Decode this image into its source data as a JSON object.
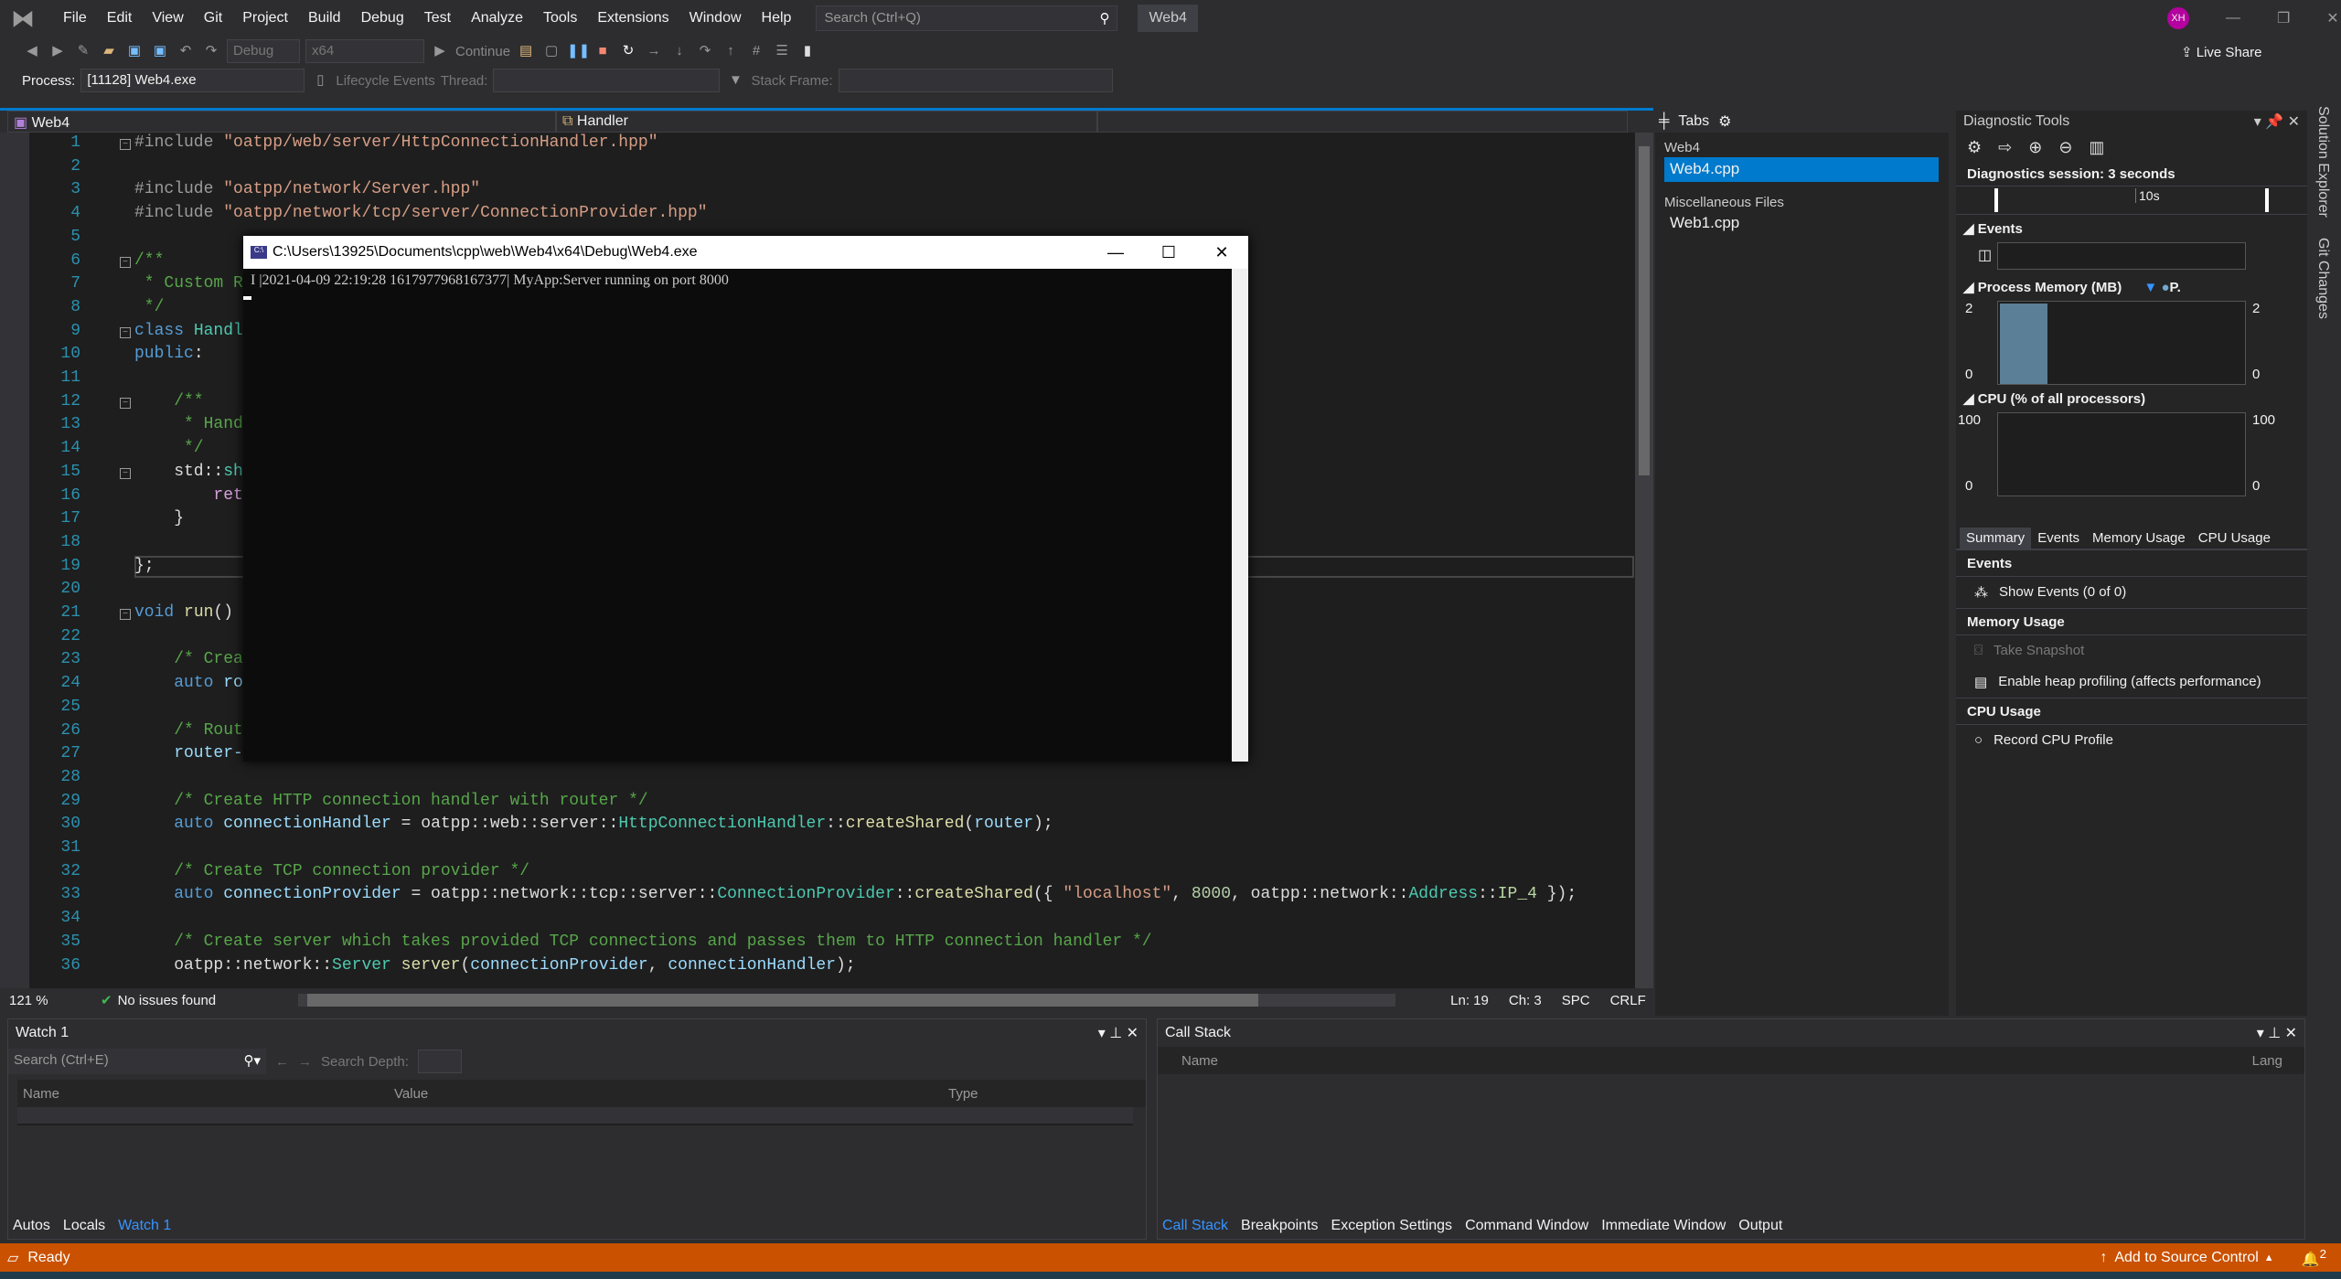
{
  "menubar": {
    "items": [
      "File",
      "Edit",
      "View",
      "Git",
      "Project",
      "Build",
      "Debug",
      "Test",
      "Analyze",
      "Tools",
      "Extensions",
      "Window",
      "Help"
    ],
    "search_placeholder": "Search (Ctrl+Q)",
    "solution": "Web4",
    "live_share": "Live Share",
    "avatar": "XH"
  },
  "toolbar": {
    "config": "Debug",
    "platform": "x64",
    "continue": "Continue",
    "process_label": "Process:",
    "process": "[11128] Web4.exe",
    "lifecycle": "Lifecycle Events",
    "thread_label": "Thread:",
    "stack_frame_label": "Stack Frame:"
  },
  "nav": {
    "project": "Web4",
    "scope": "Handler"
  },
  "editor": {
    "lines": [
      [
        [
          "p",
          "#include "
        ],
        [
          "s",
          "\"oatpp/web/server/HttpConnectionHandler.hpp\""
        ]
      ],
      [],
      [
        [
          "p",
          "#include "
        ],
        [
          "s",
          "\"oatpp/network/Server.hpp\""
        ]
      ],
      [
        [
          "p",
          "#include "
        ],
        [
          "s",
          "\"oatpp/network/tcp/server/ConnectionProvider.hpp\""
        ]
      ],
      [],
      [
        [
          "c",
          "/**"
        ]
      ],
      [
        [
          "c",
          " * Custom R"
        ]
      ],
      [
        [
          "c",
          " */"
        ]
      ],
      [
        [
          "k",
          "class "
        ],
        [
          "t",
          "Handl"
        ]
      ],
      [
        [
          "k",
          "public"
        ],
        [
          "n",
          ":"
        ]
      ],
      [],
      [
        [
          "c",
          "    /**"
        ]
      ],
      [
        [
          "c",
          "     * Hand"
        ]
      ],
      [
        [
          "c",
          "     */"
        ]
      ],
      [
        [
          "n",
          "    std::"
        ],
        [
          "t",
          "sh"
        ]
      ],
      [
        [
          "r",
          "        ret"
        ]
      ],
      [
        [
          "n",
          "    }"
        ]
      ],
      [],
      [
        [
          "n",
          "};"
        ]
      ],
      [],
      [
        [
          "k",
          "void "
        ],
        [
          "f",
          "run"
        ],
        [
          "n",
          "()"
        ]
      ],
      [],
      [
        [
          "c",
          "    /* Crea"
        ]
      ],
      [
        [
          "k",
          "    auto "
        ],
        [
          "v",
          "ro"
        ]
      ],
      [],
      [
        [
          "c",
          "    /* Rout"
        ]
      ],
      [
        [
          "v",
          "    router-"
        ]
      ],
      [],
      [
        [
          "c",
          "    /* Create HTTP connection handler with router */"
        ]
      ],
      [
        [
          "k",
          "    auto "
        ],
        [
          "v",
          "connectionHandler"
        ],
        [
          "n",
          " = oatpp::web::server::"
        ],
        [
          "t",
          "HttpConnectionHandler"
        ],
        [
          "n",
          "::"
        ],
        [
          "f",
          "createShared"
        ],
        [
          "n",
          "("
        ],
        [
          "v",
          "router"
        ],
        [
          "n",
          ");"
        ]
      ],
      [],
      [
        [
          "c",
          "    /* Create TCP connection provider */"
        ]
      ],
      [
        [
          "k",
          "    auto "
        ],
        [
          "v",
          "connectionProvider"
        ],
        [
          "n",
          " = oatpp::network::tcp::server::"
        ],
        [
          "t",
          "ConnectionProvider"
        ],
        [
          "n",
          "::"
        ],
        [
          "f",
          "createShared"
        ],
        [
          "n",
          "({ "
        ],
        [
          "s",
          "\"localhost\""
        ],
        [
          "n",
          ", "
        ],
        [
          "u",
          "8000"
        ],
        [
          "n",
          ", oatpp::network::"
        ],
        [
          "t",
          "Address"
        ],
        [
          "n",
          "::"
        ],
        [
          "e",
          "IP_4"
        ],
        [
          "n",
          " });"
        ]
      ],
      [],
      [
        [
          "c",
          "    /* Create server which takes provided TCP connections and passes them to HTTP connection handler */"
        ]
      ],
      [
        [
          "n",
          "    oatpp::network::"
        ],
        [
          "t",
          "Server"
        ],
        [
          "n",
          " "
        ],
        [
          "f",
          "server"
        ],
        [
          "n",
          "("
        ],
        [
          "v",
          "connectionProvider"
        ],
        [
          "n",
          ", "
        ],
        [
          "v",
          "connectionHandler"
        ],
        [
          "n",
          ");"
        ]
      ]
    ],
    "fold_lines": [
      1,
      6,
      9,
      12,
      15,
      21
    ],
    "current_line": 19,
    "zoom": "121 %",
    "issues": "No issues found",
    "ln": "Ln: 19",
    "ch": "Ch: 3",
    "spc": "SPC",
    "crlf": "CRLF"
  },
  "console": {
    "title": "C:\\Users\\13925\\Documents\\cpp\\web\\Web4\\x64\\Debug\\Web4.exe",
    "output": "I |2021-04-09 22:19:28 1617977968167377| MyApp:Server running on port 8000"
  },
  "tabs_panel": {
    "title": "Tabs",
    "groups": [
      {
        "name": "Web4",
        "files": [
          "Web4.cpp"
        ]
      },
      {
        "name": "Miscellaneous Files",
        "files": [
          "Web1.cpp"
        ]
      }
    ],
    "selected": "Web4.cpp"
  },
  "diagnostics": {
    "title": "Diagnostic Tools",
    "session": "Diagnostics session: 3 seconds",
    "timeline_tick": "10s",
    "events": "Events",
    "memory": "Process Memory (MB)",
    "memory_legend": "P.",
    "memory_axis": [
      "2",
      "0"
    ],
    "memory_value_mb": 2,
    "cpu": "CPU (% of all processors)",
    "cpu_axis": [
      "100",
      "0"
    ],
    "tabs": [
      "Summary",
      "Events",
      "Memory Usage",
      "CPU Usage"
    ],
    "summary": {
      "events_head": "Events",
      "show_events": "Show Events (0 of 0)",
      "memory_head": "Memory Usage",
      "snapshot": "Take Snapshot",
      "heap": "Enable heap profiling (affects performance)",
      "cpu_head": "CPU Usage",
      "record": "Record CPU Profile"
    }
  },
  "side_tabs": [
    "Solution Explorer",
    "Git Changes"
  ],
  "watch": {
    "title": "Watch 1",
    "search_placeholder": "Search (Ctrl+E)",
    "depth": "Search Depth:",
    "cols": [
      "Name",
      "Value",
      "Type"
    ],
    "tabs": [
      "Autos",
      "Locals",
      "Watch 1"
    ]
  },
  "callstack": {
    "title": "Call Stack",
    "cols": [
      "Name",
      "Lang"
    ],
    "tabs": [
      "Call Stack",
      "Breakpoints",
      "Exception Settings",
      "Command Window",
      "Immediate Window",
      "Output"
    ]
  },
  "status": {
    "ready": "Ready",
    "source_control": "Add to Source Control",
    "notifications": "2"
  },
  "colors": {
    "accent": "#007acc",
    "status_bar": "#ca5100",
    "editor_bg": "#1e1e1e"
  }
}
